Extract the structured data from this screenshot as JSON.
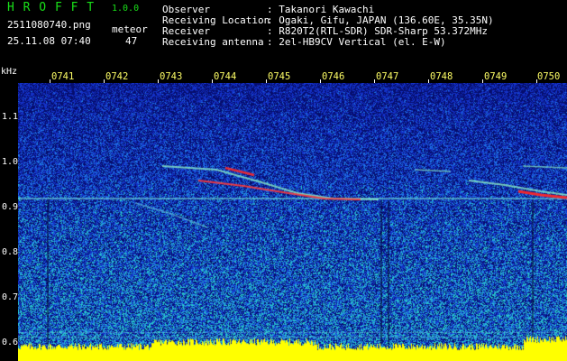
{
  "app": {
    "name": "H R O F F T",
    "version": "1.0.0",
    "filename": "2511080740.png",
    "datetime": "25.11.08 07:40",
    "meteor_label": "meteor",
    "meteor_count": "47"
  },
  "info": {
    "rows": [
      {
        "label": "Observer",
        "value": ": Takanori Kawachi"
      },
      {
        "label": "Receiving Location",
        "value": ": Ogaki, Gifu, JAPAN (136.60E, 35.35N)"
      },
      {
        "label": "Receiver",
        "value": ": R820T2(RTL-SDR) SDR-Sharp 53.372MHz"
      },
      {
        "label": "Receiving antenna",
        "value": ": 2el-HB9CV Vertical (el. E-W)"
      }
    ]
  },
  "axis": {
    "unit": "kHz",
    "time_ticks": [
      "0741",
      "0742",
      "0743",
      "0744",
      "0745",
      "0746",
      "0747",
      "0748",
      "0749",
      "0750"
    ],
    "freq_ticks": [
      "1.1",
      "1.0",
      "0.9",
      "0.8",
      "0.7",
      "0.6"
    ]
  },
  "colors": {
    "title_green": "#19e019",
    "tick_yellow": "#ffff66",
    "noise_blue": "#1a2cc0",
    "signal_red": "#ff2020",
    "level_yellow": "#ffff00"
  }
}
